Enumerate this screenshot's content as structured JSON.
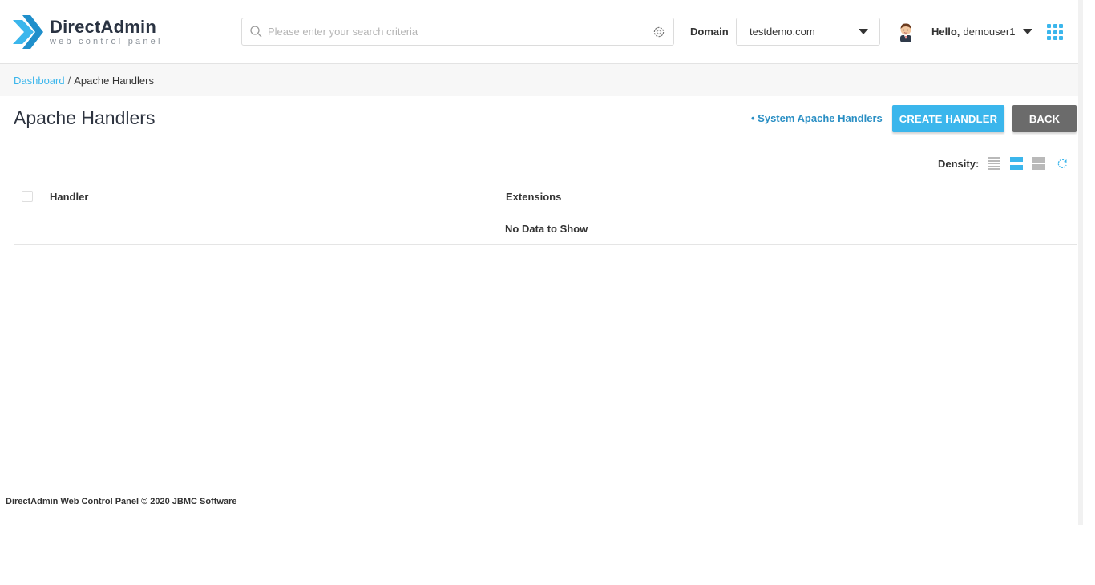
{
  "brand": {
    "title": "DirectAdmin",
    "subtitle": "web control panel",
    "accent_color": "#3bb6ec"
  },
  "search": {
    "placeholder": "Please enter your search criteria",
    "value": "",
    "icon": "search-icon",
    "settings_icon": "gear-icon"
  },
  "domain": {
    "label": "Domain",
    "selected": "testdemo.com"
  },
  "user": {
    "greeting": "Hello,",
    "name": "demouser1"
  },
  "breadcrumb": {
    "home": "Dashboard",
    "separator": "/",
    "current": "Apache Handlers"
  },
  "page": {
    "title": "Apache Handlers",
    "system_link": "• System Apache Handlers",
    "create_button": "CREATE HANDLER",
    "back_button": "BACK"
  },
  "density": {
    "label": "Density:",
    "options": [
      "compact",
      "normal",
      "wide"
    ],
    "selected": "normal"
  },
  "table": {
    "columns": [
      "Handler",
      "Extensions"
    ],
    "empty_message": "No Data to Show",
    "rows": []
  },
  "footer": {
    "text": "DirectAdmin Web Control Panel © 2020 JBMC Software"
  }
}
